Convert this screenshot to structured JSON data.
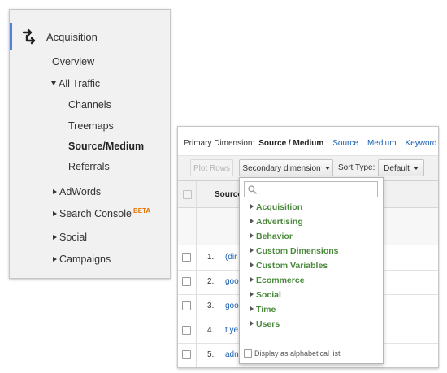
{
  "nav": {
    "acquisition": "Acquisition",
    "overview": "Overview",
    "all_traffic": "All Traffic",
    "channels": "Channels",
    "treemaps": "Treemaps",
    "source_medium": "Source/Medium",
    "referrals": "Referrals",
    "adwords": "AdWords",
    "search_console": "Search Console",
    "search_console_badge": "BETA",
    "social": "Social",
    "campaigns": "Campaigns",
    "accent_color": "#4c84d9",
    "badge_color": "#e37400"
  },
  "report": {
    "primary_dimension_label": "Primary Dimension:",
    "primary_dimension_current": "Source / Medium",
    "dimension_links": [
      "Source",
      "Medium",
      "Keyword"
    ],
    "plot_rows": "Plot Rows",
    "secondary_dimension": "Secondary dimension",
    "sort_type_label": "Sort Type:",
    "sort_type_value": "Default",
    "column_header": "Source",
    "rows": [
      {
        "num": "1.",
        "source": "(dir"
      },
      {
        "num": "2.",
        "source": "goo"
      },
      {
        "num": "3.",
        "source": "goo"
      },
      {
        "num": "4.",
        "source": "t.ye"
      },
      {
        "num": "5.",
        "source": "adn"
      }
    ],
    "link_color": "#1a5fb4"
  },
  "dropdown": {
    "search_placeholder": "",
    "items": [
      "Acquisition",
      "Advertising",
      "Behavior",
      "Custom Dimensions",
      "Custom Variables",
      "Ecommerce",
      "Social",
      "Time",
      "Users"
    ],
    "alphabetical_label": "Display as alphabetical list",
    "item_color": "#4a8a3c"
  }
}
